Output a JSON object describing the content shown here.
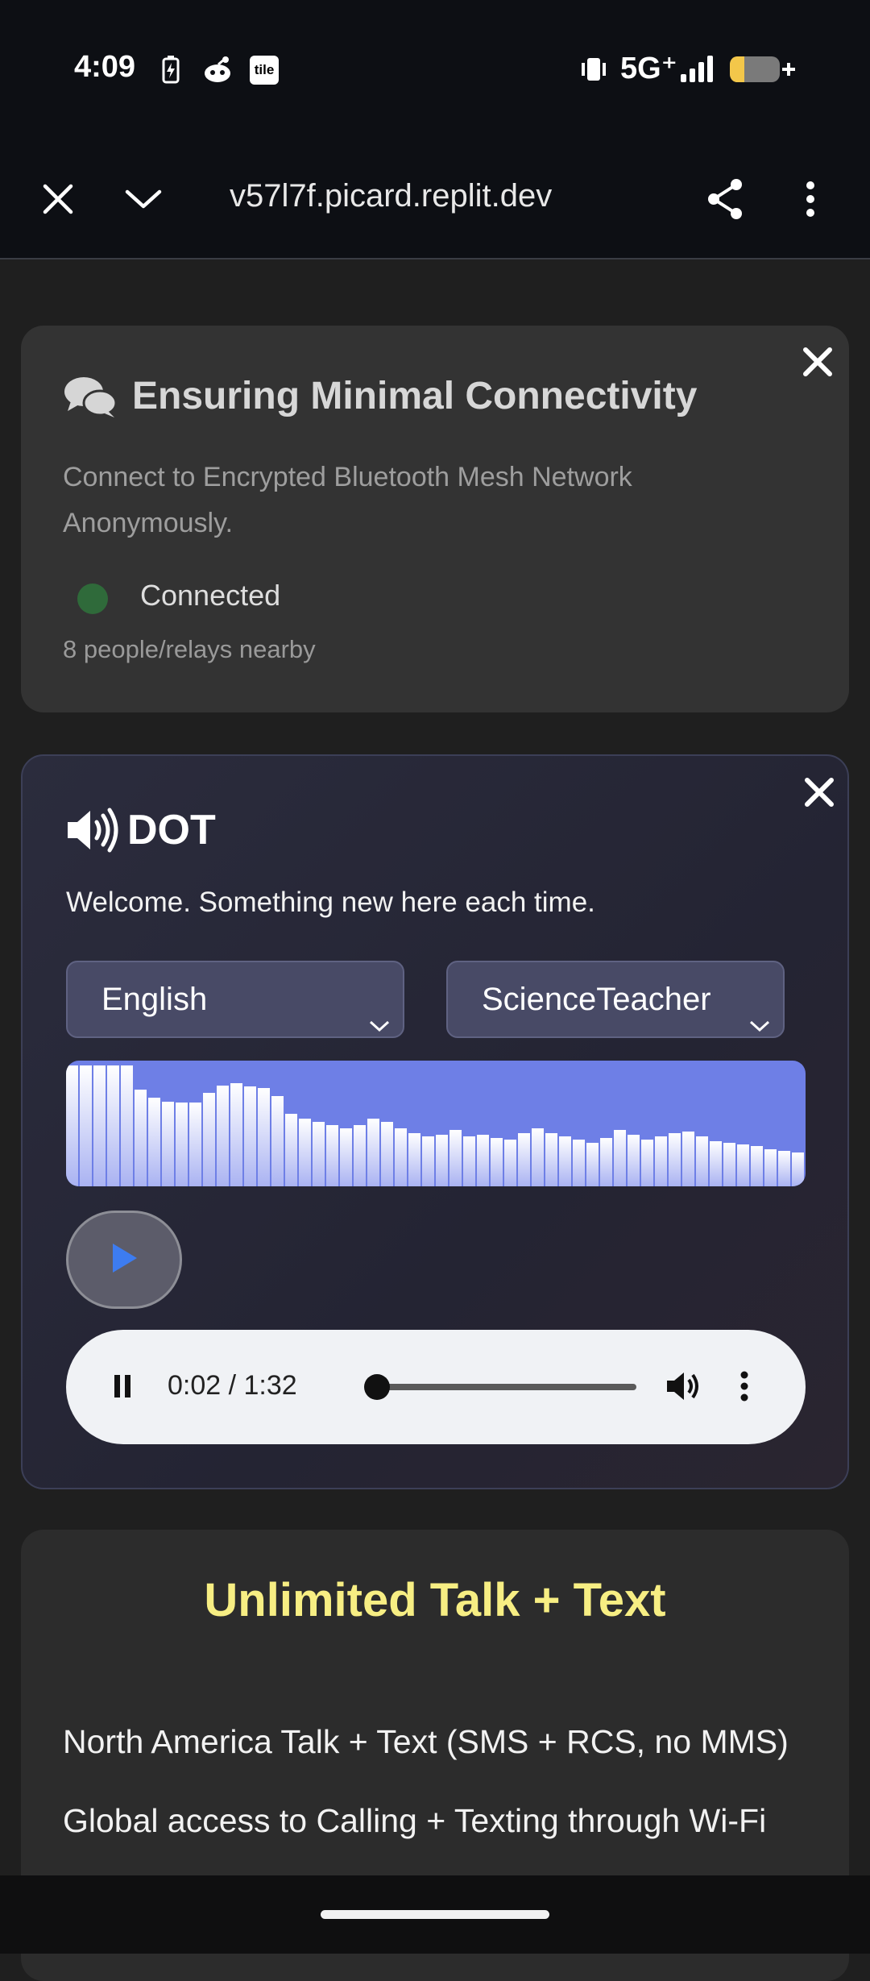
{
  "status_bar": {
    "time": "4:09",
    "tile_label": "tile",
    "network": "5G⁺",
    "icons": [
      "battery-charging-icon",
      "reddit-icon",
      "tile-icon",
      "vibrate-icon",
      "signal-icon",
      "battery-icon"
    ]
  },
  "browser": {
    "url": "v57l7f.picard.replit.dev",
    "icons": [
      "close-icon",
      "chevron-down-icon",
      "share-icon",
      "more-vert-icon"
    ]
  },
  "connectivity_card": {
    "title": "Ensuring Minimal Connectivity",
    "description": "Connect to Encrypted Bluetooth Mesh Network Anonymously.",
    "status": "Connected",
    "nearby": "8 people/relays nearby",
    "status_color": "#2f6a3a"
  },
  "dot_card": {
    "title": "DOT",
    "welcome": "Welcome. Something new here each time.",
    "language": "English",
    "persona": "ScienceTeacher",
    "audio": {
      "time": "0:02 / 1:32",
      "progress": 0.02
    },
    "accent": "#6e7fe6"
  },
  "plan_card": {
    "title": "Unlimited Talk + Text",
    "lines": [
      "North America Talk + Text (SMS + RCS, no MMS)",
      "Global access to Calling + Texting through Wi-Fi"
    ],
    "title_color": "#f7ee83"
  }
}
